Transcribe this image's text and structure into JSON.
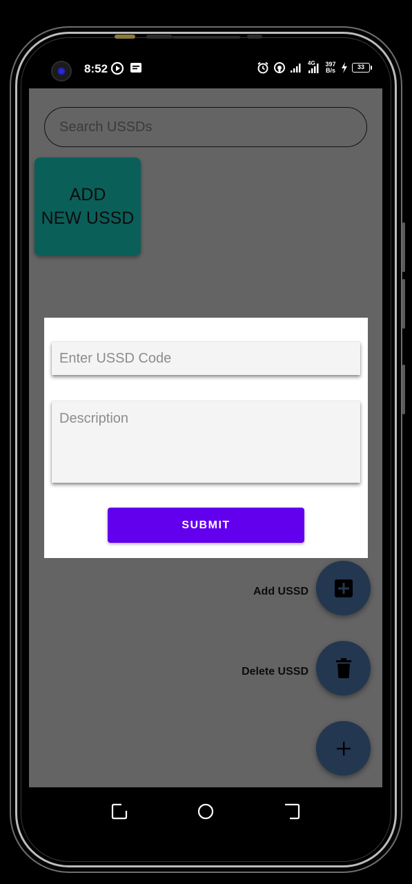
{
  "status_bar": {
    "time": "8:52",
    "network_speed_value": "397",
    "network_speed_unit": "B/s",
    "network_type": "4G",
    "battery_level": "33"
  },
  "search": {
    "placeholder": "Search USSDs"
  },
  "add_card": {
    "line1": "ADD",
    "line2": "NEW USSD",
    "color": "#0a5f59"
  },
  "dialog": {
    "code_placeholder": "Enter USSD Code",
    "description_placeholder": "Description",
    "submit_label": "SUBMIT",
    "submit_color": "#6200ee"
  },
  "fab_menu": {
    "add_label": "Add USSD",
    "delete_label": "Delete USSD",
    "fab_color": "#233750"
  },
  "icons": {
    "add_box": "add-box-icon",
    "delete": "trash-icon",
    "plus": "plus-icon"
  }
}
